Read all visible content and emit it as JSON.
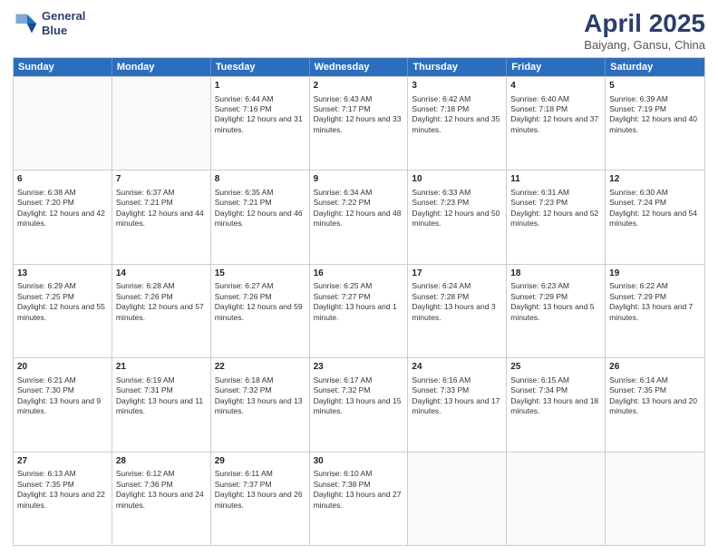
{
  "logo": {
    "line1": "General",
    "line2": "Blue"
  },
  "title": {
    "month_year": "April 2025",
    "location": "Baiyang, Gansu, China"
  },
  "days_of_week": [
    "Sunday",
    "Monday",
    "Tuesday",
    "Wednesday",
    "Thursday",
    "Friday",
    "Saturday"
  ],
  "weeks": [
    [
      {
        "day": "",
        "sunrise": "",
        "sunset": "",
        "daylight": ""
      },
      {
        "day": "",
        "sunrise": "",
        "sunset": "",
        "daylight": ""
      },
      {
        "day": "1",
        "sunrise": "Sunrise: 6:44 AM",
        "sunset": "Sunset: 7:16 PM",
        "daylight": "Daylight: 12 hours and 31 minutes."
      },
      {
        "day": "2",
        "sunrise": "Sunrise: 6:43 AM",
        "sunset": "Sunset: 7:17 PM",
        "daylight": "Daylight: 12 hours and 33 minutes."
      },
      {
        "day": "3",
        "sunrise": "Sunrise: 6:42 AM",
        "sunset": "Sunset: 7:18 PM",
        "daylight": "Daylight: 12 hours and 35 minutes."
      },
      {
        "day": "4",
        "sunrise": "Sunrise: 6:40 AM",
        "sunset": "Sunset: 7:18 PM",
        "daylight": "Daylight: 12 hours and 37 minutes."
      },
      {
        "day": "5",
        "sunrise": "Sunrise: 6:39 AM",
        "sunset": "Sunset: 7:19 PM",
        "daylight": "Daylight: 12 hours and 40 minutes."
      }
    ],
    [
      {
        "day": "6",
        "sunrise": "Sunrise: 6:38 AM",
        "sunset": "Sunset: 7:20 PM",
        "daylight": "Daylight: 12 hours and 42 minutes."
      },
      {
        "day": "7",
        "sunrise": "Sunrise: 6:37 AM",
        "sunset": "Sunset: 7:21 PM",
        "daylight": "Daylight: 12 hours and 44 minutes."
      },
      {
        "day": "8",
        "sunrise": "Sunrise: 6:35 AM",
        "sunset": "Sunset: 7:21 PM",
        "daylight": "Daylight: 12 hours and 46 minutes."
      },
      {
        "day": "9",
        "sunrise": "Sunrise: 6:34 AM",
        "sunset": "Sunset: 7:22 PM",
        "daylight": "Daylight: 12 hours and 48 minutes."
      },
      {
        "day": "10",
        "sunrise": "Sunrise: 6:33 AM",
        "sunset": "Sunset: 7:23 PM",
        "daylight": "Daylight: 12 hours and 50 minutes."
      },
      {
        "day": "11",
        "sunrise": "Sunrise: 6:31 AM",
        "sunset": "Sunset: 7:23 PM",
        "daylight": "Daylight: 12 hours and 52 minutes."
      },
      {
        "day": "12",
        "sunrise": "Sunrise: 6:30 AM",
        "sunset": "Sunset: 7:24 PM",
        "daylight": "Daylight: 12 hours and 54 minutes."
      }
    ],
    [
      {
        "day": "13",
        "sunrise": "Sunrise: 6:29 AM",
        "sunset": "Sunset: 7:25 PM",
        "daylight": "Daylight: 12 hours and 55 minutes."
      },
      {
        "day": "14",
        "sunrise": "Sunrise: 6:28 AM",
        "sunset": "Sunset: 7:26 PM",
        "daylight": "Daylight: 12 hours and 57 minutes."
      },
      {
        "day": "15",
        "sunrise": "Sunrise: 6:27 AM",
        "sunset": "Sunset: 7:26 PM",
        "daylight": "Daylight: 12 hours and 59 minutes."
      },
      {
        "day": "16",
        "sunrise": "Sunrise: 6:25 AM",
        "sunset": "Sunset: 7:27 PM",
        "daylight": "Daylight: 13 hours and 1 minute."
      },
      {
        "day": "17",
        "sunrise": "Sunrise: 6:24 AM",
        "sunset": "Sunset: 7:28 PM",
        "daylight": "Daylight: 13 hours and 3 minutes."
      },
      {
        "day": "18",
        "sunrise": "Sunrise: 6:23 AM",
        "sunset": "Sunset: 7:29 PM",
        "daylight": "Daylight: 13 hours and 5 minutes."
      },
      {
        "day": "19",
        "sunrise": "Sunrise: 6:22 AM",
        "sunset": "Sunset: 7:29 PM",
        "daylight": "Daylight: 13 hours and 7 minutes."
      }
    ],
    [
      {
        "day": "20",
        "sunrise": "Sunrise: 6:21 AM",
        "sunset": "Sunset: 7:30 PM",
        "daylight": "Daylight: 13 hours and 9 minutes."
      },
      {
        "day": "21",
        "sunrise": "Sunrise: 6:19 AM",
        "sunset": "Sunset: 7:31 PM",
        "daylight": "Daylight: 13 hours and 11 minutes."
      },
      {
        "day": "22",
        "sunrise": "Sunrise: 6:18 AM",
        "sunset": "Sunset: 7:32 PM",
        "daylight": "Daylight: 13 hours and 13 minutes."
      },
      {
        "day": "23",
        "sunrise": "Sunrise: 6:17 AM",
        "sunset": "Sunset: 7:32 PM",
        "daylight": "Daylight: 13 hours and 15 minutes."
      },
      {
        "day": "24",
        "sunrise": "Sunrise: 6:16 AM",
        "sunset": "Sunset: 7:33 PM",
        "daylight": "Daylight: 13 hours and 17 minutes."
      },
      {
        "day": "25",
        "sunrise": "Sunrise: 6:15 AM",
        "sunset": "Sunset: 7:34 PM",
        "daylight": "Daylight: 13 hours and 18 minutes."
      },
      {
        "day": "26",
        "sunrise": "Sunrise: 6:14 AM",
        "sunset": "Sunset: 7:35 PM",
        "daylight": "Daylight: 13 hours and 20 minutes."
      }
    ],
    [
      {
        "day": "27",
        "sunrise": "Sunrise: 6:13 AM",
        "sunset": "Sunset: 7:35 PM",
        "daylight": "Daylight: 13 hours and 22 minutes."
      },
      {
        "day": "28",
        "sunrise": "Sunrise: 6:12 AM",
        "sunset": "Sunset: 7:36 PM",
        "daylight": "Daylight: 13 hours and 24 minutes."
      },
      {
        "day": "29",
        "sunrise": "Sunrise: 6:11 AM",
        "sunset": "Sunset: 7:37 PM",
        "daylight": "Daylight: 13 hours and 26 minutes."
      },
      {
        "day": "30",
        "sunrise": "Sunrise: 6:10 AM",
        "sunset": "Sunset: 7:38 PM",
        "daylight": "Daylight: 13 hours and 27 minutes."
      },
      {
        "day": "",
        "sunrise": "",
        "sunset": "",
        "daylight": ""
      },
      {
        "day": "",
        "sunrise": "",
        "sunset": "",
        "daylight": ""
      },
      {
        "day": "",
        "sunrise": "",
        "sunset": "",
        "daylight": ""
      }
    ]
  ]
}
